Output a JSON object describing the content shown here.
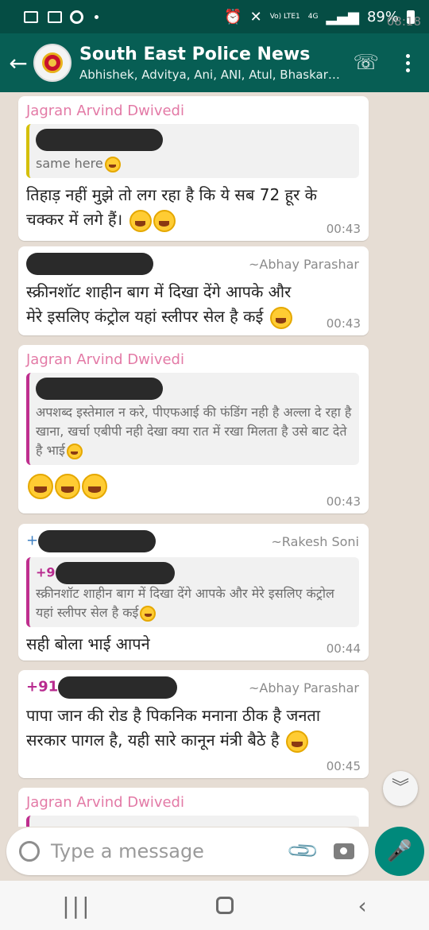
{
  "status": {
    "time": "08:18",
    "battery": "89%",
    "network": "4G",
    "volte": "Vo) LTE1"
  },
  "header": {
    "back_icon": "arrow-left-icon",
    "title": "South East Police News",
    "subtitle": "Abhishek, Advitya, Ani, ANI, Atul, Bhaskar,...",
    "icons": [
      "add-call-icon",
      "more-vert-icon"
    ]
  },
  "colors": {
    "header": "#075e54",
    "statusbar": "#054d44",
    "accent": "#00897b",
    "sender_pink": "#e37aa6",
    "sender_green": "#b82b8f"
  },
  "messages": [
    {
      "sender": "Jagran Arvind Dwivedi",
      "quote": "same here",
      "text": "तिहाड़ नहीं मुझे तो लग रहा है कि ये सब 72 हूर के चक्कर में लगे हैं।",
      "time": "00:43"
    },
    {
      "alias": "~Abhay Parashar",
      "text": "स्क्रीनशॉट शाहीन बाग में दिखा देंगे आपके और मेरे इसलिए कंट्रोल यहां स्लीपर सेल है कई",
      "time": "00:43"
    },
    {
      "sender": "Jagran Arvind Dwivedi",
      "quote": "अपशब्द इस्तेमाल न करे, पीएफआई की फंडिंग नही है अल्ला दे रहा है खाना, खर्चा एबीपी नही देखा क्या रात में रखा मिलता है उसे बाट देते है भाई",
      "time": "00:43"
    },
    {
      "sender_prefix": "+",
      "alias": "~Rakesh Soni",
      "quote_prefix": "+9",
      "quote": "स्क्रीनशॉट शाहीन बाग में दिखा देंगे आपके और मेरे इसलिए कंट्रोल यहां स्लीपर सेल है कई",
      "text": "सही बोला भाई आपने",
      "time": "00:44"
    },
    {
      "sender_prefix": "+91",
      "alias": "~Abhay Parashar",
      "text": "पापा जान की रोड है पिकनिक मनाना ठीक है जनता सरकार पागल है, यही सारे कानून मंत्री बैठे है",
      "time": "00:45"
    },
    {
      "sender": "Jagran Arvind Dwivedi"
    }
  ],
  "input": {
    "placeholder": "Type a message"
  }
}
